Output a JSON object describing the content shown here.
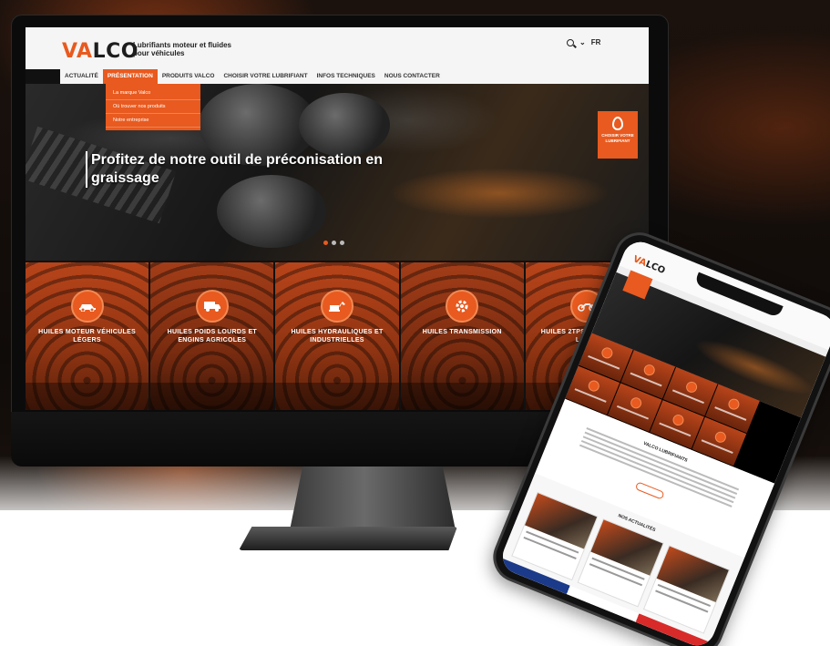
{
  "site": {
    "logo_prefix": "VA",
    "logo_suffix": "LCO",
    "tagline": "Lubrifiants moteur et fluides pour véhicules",
    "lang": "FR"
  },
  "nav": {
    "items": [
      {
        "label": "ACTUALITÉ"
      },
      {
        "label": "PRÉSENTATION"
      },
      {
        "label": "PRODUITS VALCO"
      },
      {
        "label": "CHOISIR VOTRE LUBRIFIANT"
      },
      {
        "label": "INFOS TECHNIQUES"
      },
      {
        "label": "NOUS CONTACTER"
      }
    ],
    "dropdown": [
      {
        "label": "La marque Valco"
      },
      {
        "label": "Où trouver nos produits"
      },
      {
        "label": "Notre entreprise"
      }
    ]
  },
  "hero": {
    "title": "Profitez de notre outil de préconisation en graissage",
    "cta": "CHOISIR VOTRE LUBRIFIANT"
  },
  "categories": [
    {
      "label": "HUILES MOTEUR VÉHICULES LÉGERS",
      "icon": "car-icon"
    },
    {
      "label": "HUILES POIDS LOURDS ET ENGINS AGRICOLES",
      "icon": "truck-icon"
    },
    {
      "label": "HUILES HYDRAULIQUES ET INDUSTRIELLES",
      "icon": "excavator-icon"
    },
    {
      "label": "HUILES TRANSMISSION",
      "icon": "gear-icon"
    },
    {
      "label": "HUILES 2TPS & 4TPS MOTO LOISIR",
      "icon": "motorbike-icon"
    }
  ],
  "mobile": {
    "section_title": "VALCO LUBRIFIANTS",
    "news_title": "NOS ACTUALITÉS"
  },
  "colors": {
    "accent": "#e85a1f",
    "dark": "#1d1d1d"
  }
}
